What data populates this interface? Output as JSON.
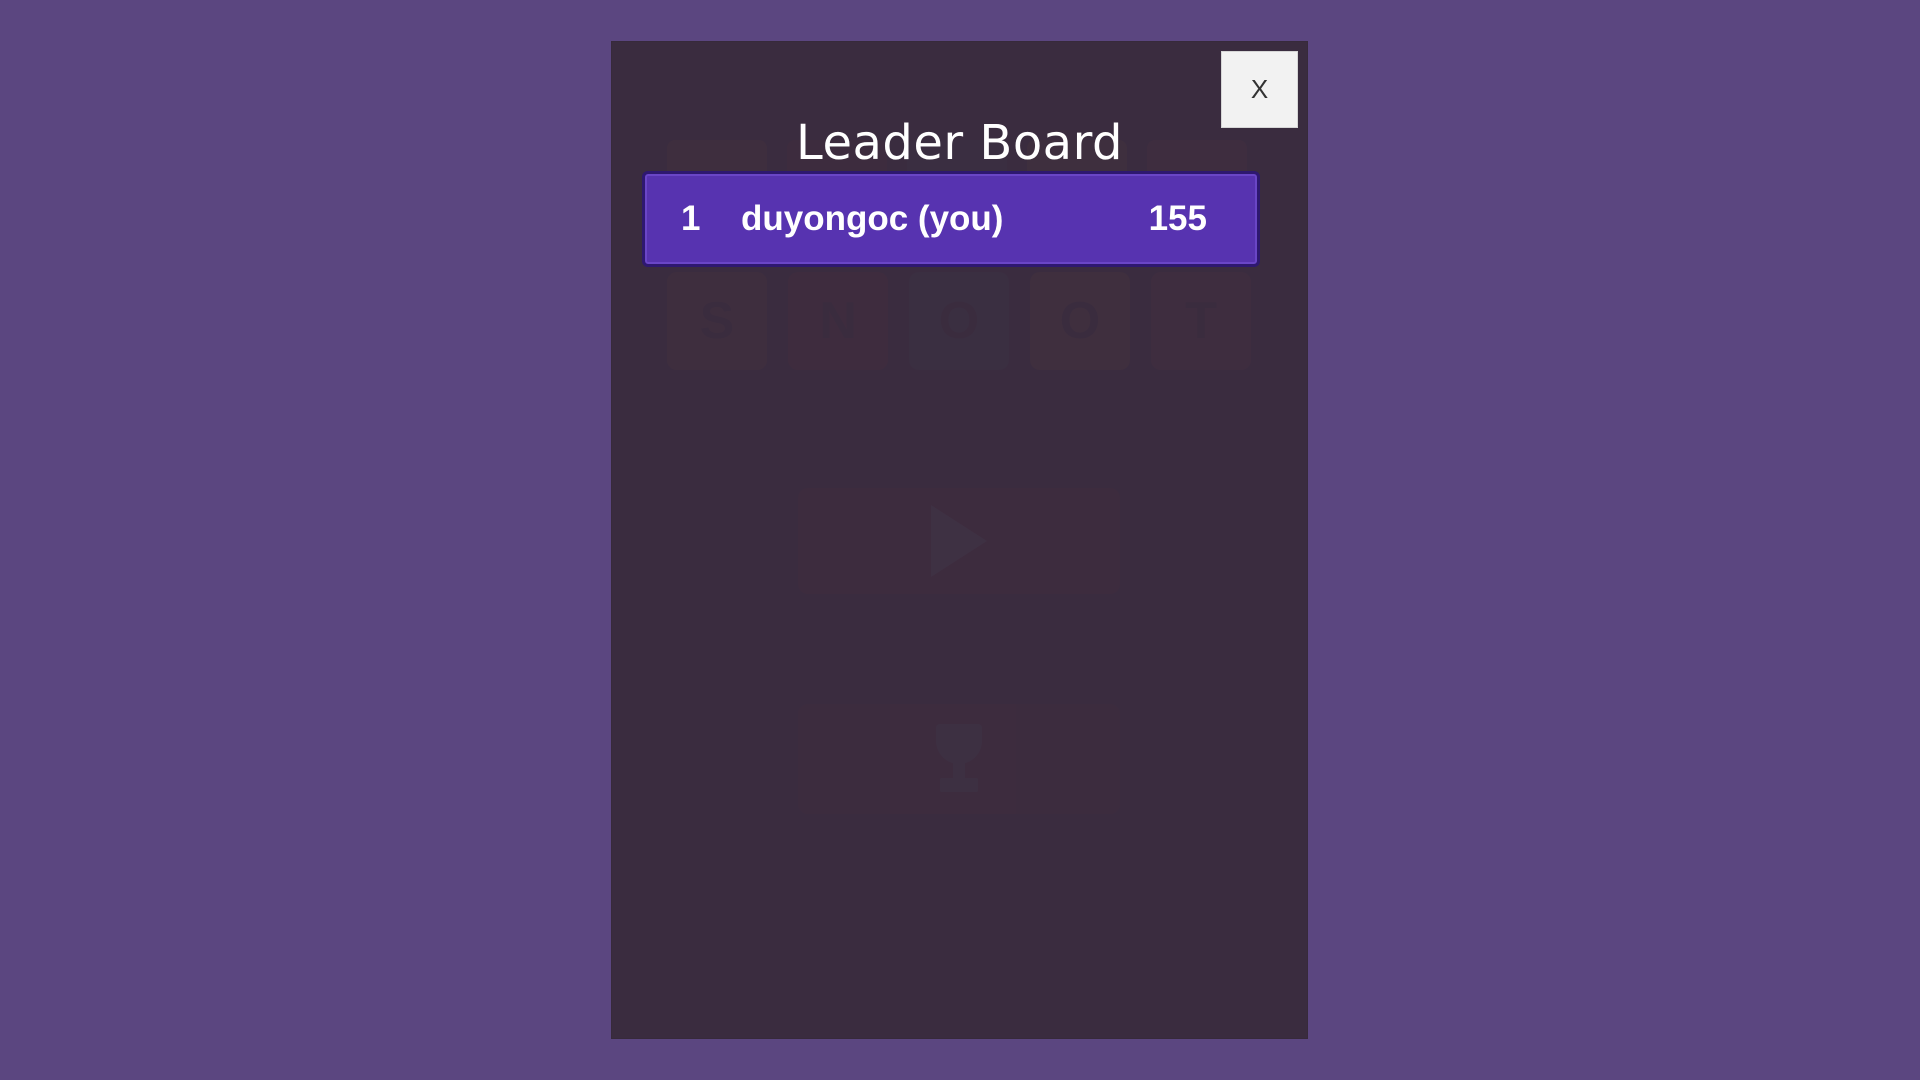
{
  "colors": {
    "background": "#5b4680",
    "panel": "#3d2e4b",
    "row": "#5733b0",
    "tile_s": "#d86a2a",
    "tile_n": "#c0282e",
    "tile_o1": "#2f7fa8",
    "tile_o2": "#e28a1f",
    "tile_t": "#d94a5a"
  },
  "background_game": {
    "tiles": [
      "S",
      "N",
      "O",
      "O",
      "T"
    ]
  },
  "modal": {
    "title": "Leader Board",
    "close_label": "X"
  },
  "leaderboard": {
    "entries": [
      {
        "rank": "1",
        "name": "duyongoc (you)",
        "score": "155"
      }
    ]
  },
  "icons": [
    "play-icon",
    "trophy-icon"
  ]
}
